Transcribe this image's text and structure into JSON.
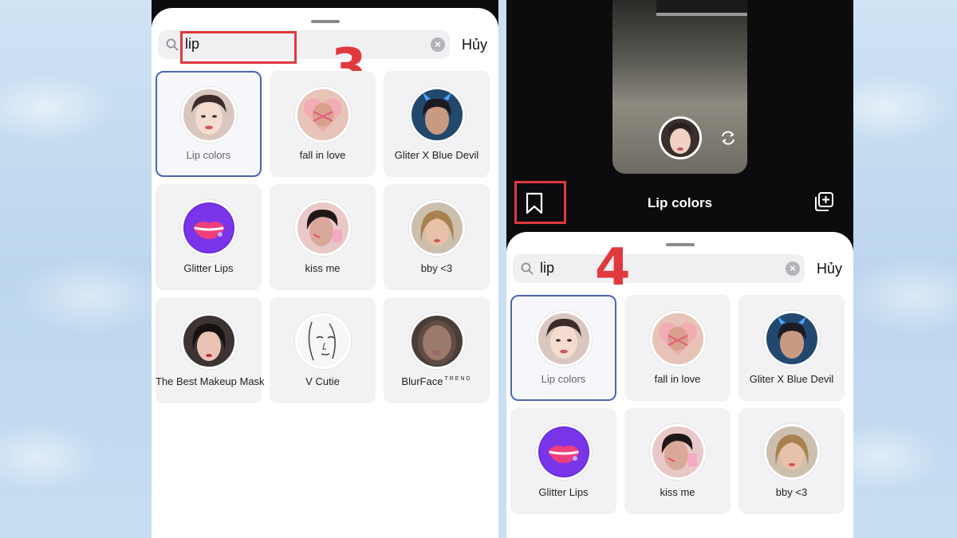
{
  "left_panel": {
    "search": {
      "query": "lip",
      "cancel_label": "Hủy"
    },
    "step_label": "3",
    "effects": [
      {
        "name": "Lip colors",
        "selected": true,
        "thumb": "face-pale"
      },
      {
        "name": "fall in love",
        "selected": false,
        "thumb": "heart"
      },
      {
        "name": "Gliter X Blue Devil",
        "selected": false,
        "thumb": "blue-devil"
      },
      {
        "name": "Glitter Lips",
        "selected": false,
        "thumb": "glitter-lips"
      },
      {
        "name": "kiss me",
        "selected": false,
        "thumb": "kiss"
      },
      {
        "name": "bby <3",
        "selected": false,
        "thumb": "bby"
      },
      {
        "name": "The Best Makeup Mask",
        "selected": false,
        "thumb": "makeup"
      },
      {
        "name": "V Cutie",
        "selected": false,
        "thumb": "sketch"
      },
      {
        "name": "BlurFace",
        "badge": "TREND",
        "selected": false,
        "thumb": "blur"
      }
    ]
  },
  "right_panel": {
    "effect_title": "Lip colors",
    "search": {
      "query": "lip",
      "cancel_label": "Hủy"
    },
    "step_label": "4",
    "effects": [
      {
        "name": "Lip colors",
        "selected": true,
        "thumb": "face-pale"
      },
      {
        "name": "fall in love",
        "selected": false,
        "thumb": "heart"
      },
      {
        "name": "Gliter X Blue Devil",
        "selected": false,
        "thumb": "blue-devil"
      },
      {
        "name": "Glitter Lips",
        "selected": false,
        "thumb": "glitter-lips"
      },
      {
        "name": "kiss me",
        "selected": false,
        "thumb": "kiss"
      },
      {
        "name": "bby <3",
        "selected": false,
        "thumb": "bby"
      }
    ]
  },
  "colors": {
    "highlight_red": "#e0393e",
    "selected_border": "#4a66b5",
    "tile_bg": "#f2f2f4"
  }
}
